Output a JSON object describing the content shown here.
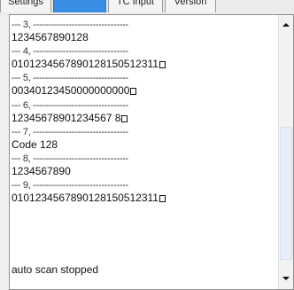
{
  "tabs": [
    {
      "label": "Settings",
      "active": false
    },
    {
      "label": "",
      "active": true
    },
    {
      "label": "TC Input",
      "active": false
    },
    {
      "label": "Version",
      "active": false
    }
  ],
  "log": {
    "lines": [
      {
        "kind": "sep",
        "text": "--- 3, --------------------------------"
      },
      {
        "kind": "value",
        "text": "1234567890128",
        "box": false
      },
      {
        "kind": "sep",
        "text": "--- 4, --------------------------------"
      },
      {
        "kind": "value",
        "text": "0101234567890128150512311",
        "box": true
      },
      {
        "kind": "sep",
        "text": "--- 5, --------------------------------"
      },
      {
        "kind": "value",
        "text": "00340123450000000000",
        "box": true
      },
      {
        "kind": "sep",
        "text": "--- 6, --------------------------------"
      },
      {
        "kind": "value",
        "text": "12345678901234567 8",
        "box": true
      },
      {
        "kind": "sep",
        "text": "--- 7, --------------------------------"
      },
      {
        "kind": "value",
        "text": "Code 128",
        "box": false
      },
      {
        "kind": "sep",
        "text": "--- 8, --------------------------------"
      },
      {
        "kind": "value",
        "text": "1234567890",
        "box": false
      },
      {
        "kind": "sep",
        "text": "--- 9, --------------------------------"
      },
      {
        "kind": "value",
        "text": "0101234567890128150512311",
        "box": true
      }
    ],
    "status": "auto scan stopped"
  },
  "scrollbar": {
    "up_icon": "scroll-up-arrow",
    "down_icon": "scroll-down-arrow"
  }
}
